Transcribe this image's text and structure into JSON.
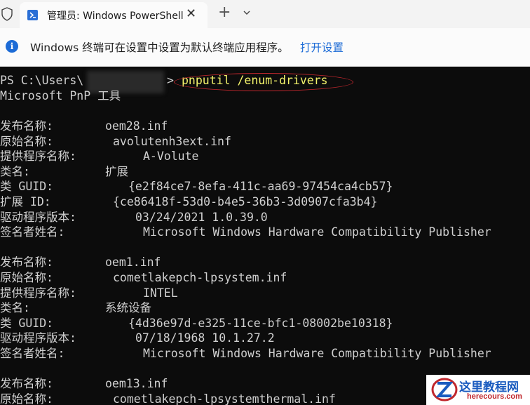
{
  "tab": {
    "title": "管理员: Windows PowerShell",
    "close": "✕"
  },
  "toolbar": {
    "new_tab": "+"
  },
  "infobar": {
    "message": "Windows 终端可在设置中设置为默认终端应用程序。",
    "link": "打开设置"
  },
  "terminal": {
    "prompt": "PS C:\\Users\\",
    "prompt_end": ">",
    "command": "pnputil /enum-drivers",
    "tool_line": "Microsoft PnP 工具",
    "lines": [
      {
        "label": "发布名称:",
        "value": "oem28.inf",
        "offset": 150
      },
      {
        "label": "原始名称:",
        "value": "avolutenh3ext.inf",
        "offset": 161
      },
      {
        "label": "提供程序名称:",
        "value": "A-Volute",
        "offset": 204
      },
      {
        "label": "类名:",
        "value": "扩展",
        "offset": 150
      },
      {
        "label": "类 GUID:",
        "value": "{e2f84ce7-8efa-411c-aa69-97454ca4cb57}",
        "offset": 183
      },
      {
        "label": "扩展 ID:",
        "value": "{ce86418f-53d0-b4e5-36b3-3d0907cfa3b4}",
        "offset": 161
      },
      {
        "label": "驱动程序版本:",
        "value": "03/24/2021 1.0.39.0",
        "offset": 193
      },
      {
        "label": "签名者姓名:",
        "value": "Microsoft Windows Hardware Compatibility Publisher",
        "offset": 204
      },
      {
        "label": "",
        "value": "",
        "offset": 0
      },
      {
        "label": "发布名称:",
        "value": "oem1.inf",
        "offset": 150
      },
      {
        "label": "原始名称:",
        "value": "cometlakepch-lpsystem.inf",
        "offset": 161
      },
      {
        "label": "提供程序名称:",
        "value": "INTEL",
        "offset": 204
      },
      {
        "label": "类名:",
        "value": "系统设备",
        "offset": 150
      },
      {
        "label": "类 GUID:",
        "value": "{4d36e97d-e325-11ce-bfc1-08002be10318}",
        "offset": 183
      },
      {
        "label": "驱动程序版本:",
        "value": "07/18/1968 10.1.27.2",
        "offset": 193
      },
      {
        "label": "签名者姓名:",
        "value": "Microsoft Windows Hardware Compatibility Publisher",
        "offset": 204
      },
      {
        "label": "",
        "value": "",
        "offset": 0
      },
      {
        "label": "发布名称:",
        "value": "oem13.inf",
        "offset": 150
      },
      {
        "label": "原始名称:",
        "value": "cometlakepch-lpsystemthermal.inf",
        "offset": 161
      }
    ]
  },
  "watermark": {
    "name": "这里教程网",
    "url": "herecours.com"
  },
  "colors": {
    "accent": "#1c6bd6",
    "terminal_bg": "#0c0c0c",
    "annotation": "#c0272d"
  }
}
